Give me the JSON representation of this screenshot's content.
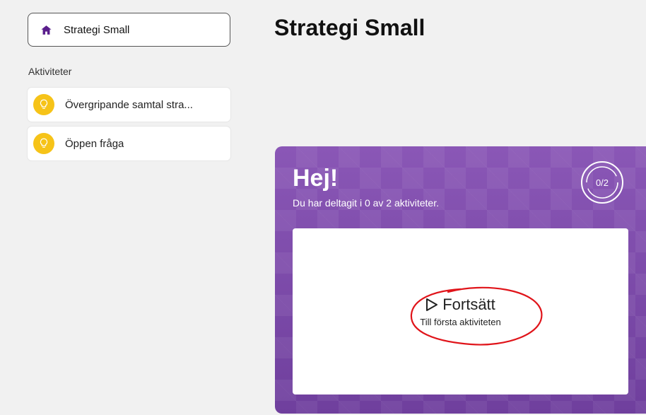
{
  "sidebar": {
    "home_label": "Strategi Small",
    "section_label": "Aktiviteter",
    "activities": [
      {
        "label": "Övergripande samtal stra..."
      },
      {
        "label": "Öppen fråga"
      }
    ]
  },
  "main": {
    "title": "Strategi Small",
    "card": {
      "greeting": "Hej!",
      "subtext": "Du har deltagit i 0 av 2 aktiviteter.",
      "progress_label": "0/2",
      "progress_completed": 0,
      "progress_total": 2,
      "continue_label": "Fortsätt",
      "continue_sub": "Till första aktiviteten"
    }
  },
  "colors": {
    "accent_purple": "#7b4aa7",
    "bulb_yellow": "#f6c318",
    "home_icon": "#5a1e8c",
    "annotation_red": "#e0141a"
  }
}
